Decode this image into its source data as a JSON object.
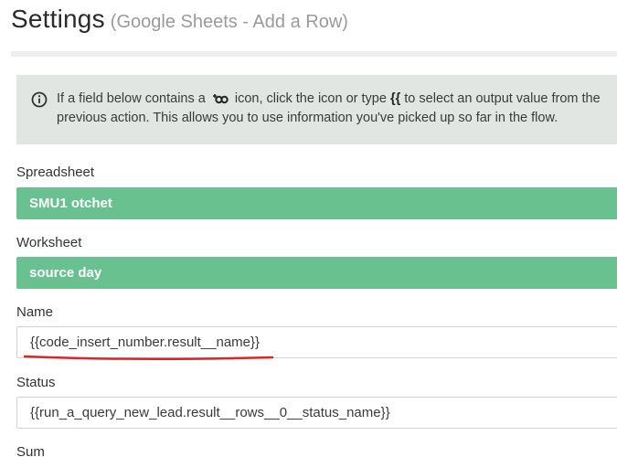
{
  "header": {
    "title": "Settings",
    "subtitle": "(Google Sheets - Add a Row)"
  },
  "info": {
    "icon": "info-icon",
    "text_before": "If a field below contains a",
    "text_middle": "icon, click the icon or type",
    "braces": "{{",
    "text_after": "to select an output value from the",
    "line2": "previous action. This allows you to use information you've picked up so far in the flow."
  },
  "fields": {
    "spreadsheet": {
      "label": "Spreadsheet",
      "value": "SMU1 otchet"
    },
    "worksheet": {
      "label": "Worksheet",
      "value": "source day"
    },
    "name": {
      "label": "Name",
      "value": "{{code_insert_number.result__name}}"
    },
    "status": {
      "label": "Status",
      "value": "{{run_a_query_new_lead.result__rows__0__status_name}}"
    },
    "sum": {
      "label": "Sum"
    }
  },
  "colors": {
    "select_green": "#68c18f",
    "info_bg": "#e1e6e3",
    "annotation_red": "#d9262b"
  }
}
